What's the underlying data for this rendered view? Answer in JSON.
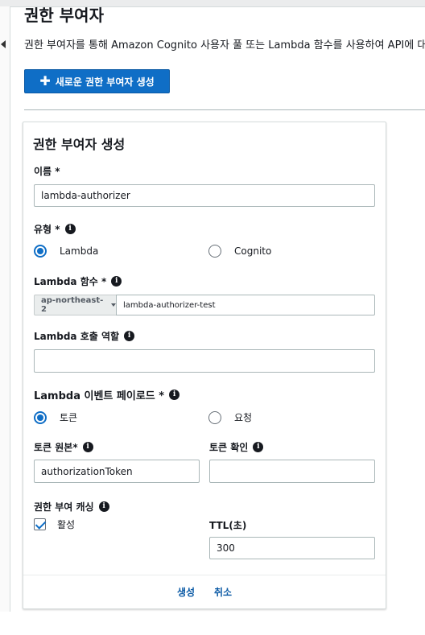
{
  "page": {
    "title": "권한 부여자",
    "description": "권한 부여자를 통해 Amazon Cognito 사용자 풀 또는 Lambda 함수를 사용하여 API에 대",
    "create_button_label": "새로운 권한 부여자 생성"
  },
  "form": {
    "title": "권한 부여자 생성",
    "name_label": "이름 *",
    "name_value": "lambda-authorizer",
    "type_label": "유형 *",
    "type_options": [
      "Lambda",
      "Cognito"
    ],
    "type_selected": "Lambda",
    "lambda_function_label": "Lambda 함수 *",
    "region_value": "ap-northeast-2",
    "lambda_function_value": "lambda-authorizer-test",
    "invoke_role_label": "Lambda 호출 역할",
    "invoke_role_value": "",
    "payload_label": "Lambda 이벤트 페이로드 *",
    "payload_options": [
      "토큰",
      "요청"
    ],
    "payload_selected": "토큰",
    "token_source_label": "토큰 원본*",
    "token_source_value": "authorizationToken",
    "token_validation_label": "토큰 확인",
    "token_validation_value": "",
    "caching_label": "권한 부여 캐싱",
    "caching_checkbox_label": "활성",
    "caching_enabled": true,
    "ttl_label": "TTL(초)",
    "ttl_value": "300",
    "create_label": "생성",
    "cancel_label": "취소"
  },
  "icons": {
    "info": "info-icon",
    "plus": "plus-icon",
    "collapse": "chevron-left-icon",
    "dropdown": "caret-down-icon"
  },
  "colors": {
    "primary": "#0f6ec6",
    "link": "#0b5aa5",
    "text": "#16191f",
    "border": "#aab7b8"
  }
}
